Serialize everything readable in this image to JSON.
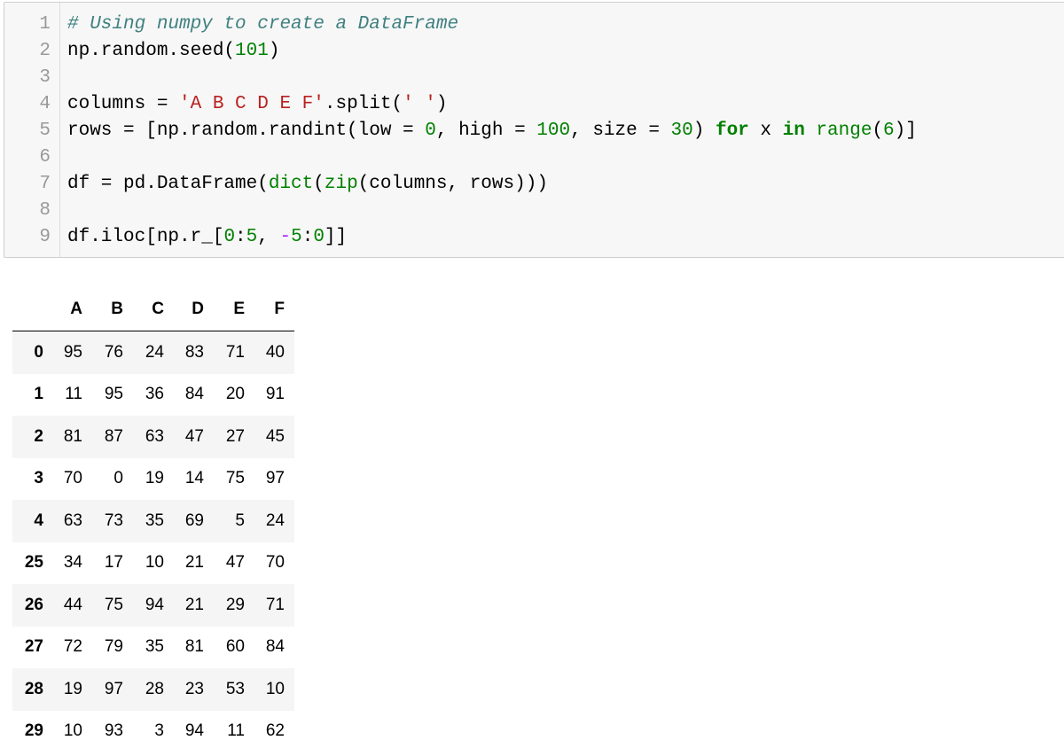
{
  "code_cell": {
    "line_numbers": [
      "1",
      "2",
      "3",
      "4",
      "5",
      "6",
      "7",
      "8",
      "9"
    ],
    "lines": {
      "l1": {
        "comment": "# Using numpy to create a DataFrame"
      },
      "l2": {
        "a": "np.random.seed(",
        "n": "101",
        "b": ")"
      },
      "l4": {
        "a": "columns = ",
        "s": "'A B C D E F'",
        "b": ".split(",
        "s2": "' '",
        "c": ")"
      },
      "l5": {
        "a": "rows = [np.random.randint(low = ",
        "n1": "0",
        "b": ", high = ",
        "n2": "100",
        "c": ", size = ",
        "n3": "30",
        "d": ") ",
        "k1": "for",
        "e": " x ",
        "k2": "in",
        "f": " ",
        "bi": "range",
        "g": "(",
        "n4": "6",
        "h": ")]"
      },
      "l7": {
        "a": "df = pd.DataFrame(",
        "bi1": "dict",
        "b": "(",
        "bi2": "zip",
        "c": "(columns, rows)))"
      },
      "l9": {
        "a": "df.iloc[np.r_[",
        "n1": "0",
        "b": ":",
        "n2": "5",
        "c": ", ",
        "op": "-",
        "n3": "5",
        "d": ":",
        "n4": "0",
        "e": "]]"
      }
    }
  },
  "output_table": {
    "columns": [
      "A",
      "B",
      "C",
      "D",
      "E",
      "F"
    ],
    "rows": [
      {
        "index": "0",
        "values": [
          "95",
          "76",
          "24",
          "83",
          "71",
          "40"
        ]
      },
      {
        "index": "1",
        "values": [
          "11",
          "95",
          "36",
          "84",
          "20",
          "91"
        ]
      },
      {
        "index": "2",
        "values": [
          "81",
          "87",
          "63",
          "47",
          "27",
          "45"
        ]
      },
      {
        "index": "3",
        "values": [
          "70",
          "0",
          "19",
          "14",
          "75",
          "97"
        ]
      },
      {
        "index": "4",
        "values": [
          "63",
          "73",
          "35",
          "69",
          "5",
          "24"
        ]
      },
      {
        "index": "25",
        "values": [
          "34",
          "17",
          "10",
          "21",
          "47",
          "70"
        ]
      },
      {
        "index": "26",
        "values": [
          "44",
          "75",
          "94",
          "21",
          "29",
          "71"
        ]
      },
      {
        "index": "27",
        "values": [
          "72",
          "79",
          "35",
          "81",
          "60",
          "84"
        ]
      },
      {
        "index": "28",
        "values": [
          "19",
          "97",
          "28",
          "23",
          "53",
          "10"
        ]
      },
      {
        "index": "29",
        "values": [
          "10",
          "93",
          "3",
          "94",
          "11",
          "62"
        ]
      }
    ]
  }
}
